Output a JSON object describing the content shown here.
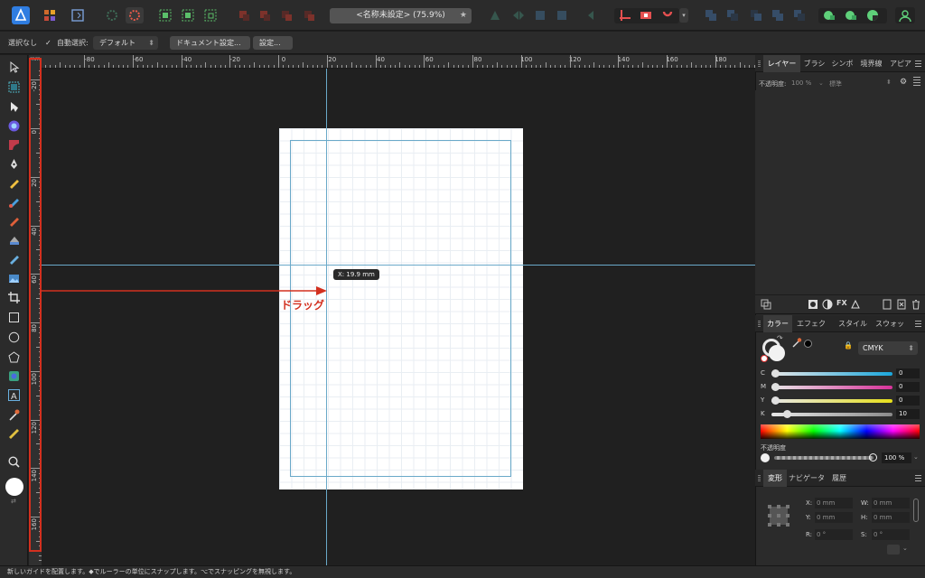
{
  "toolbar": {
    "document_title": "<名称未設定> (75.9%)",
    "favorite_icon": "star-icon"
  },
  "context_bar": {
    "selection_label": "選択なし",
    "auto_select_label": "自動選択:",
    "auto_select_value": "デフォルト",
    "document_setup_button": "ドキュメント設定...",
    "settings_button": "設定..."
  },
  "ruler": {
    "unit": "mm",
    "h_labels": [
      "-80",
      "-60",
      "-40",
      "-20",
      "0",
      "20",
      "40",
      "60",
      "80",
      "100",
      "120",
      "140",
      "160",
      "180"
    ],
    "v_labels": [
      "-20",
      "0",
      "20",
      "40",
      "60",
      "80",
      "100",
      "120",
      "140",
      "160"
    ]
  },
  "canvas": {
    "coordinate_tooltip": "X: 19.9 mm",
    "drag_annotation": "ドラッグ",
    "annotation_color": "#d3301f",
    "guide_color": "#6aa9c9"
  },
  "layers_panel": {
    "tabs": [
      "レイヤー",
      "ブラシ",
      "シンボ",
      "境界線",
      "アピア"
    ],
    "opacity_label": "不透明度:",
    "opacity_value": "100 %",
    "blend_mode": "標準"
  },
  "color_panel": {
    "tabs": [
      "カラー",
      "エフェク",
      "スタイル",
      "スウォッ"
    ],
    "model": "CMYK",
    "channels": [
      {
        "label": "C",
        "value": "0",
        "color": "#1aa7dc"
      },
      {
        "label": "M",
        "value": "0",
        "color": "#d8329a"
      },
      {
        "label": "Y",
        "value": "0",
        "color": "#e6df1a"
      },
      {
        "label": "K",
        "value": "10",
        "color": "#8a8a8a"
      }
    ],
    "opacity_label": "不透明度",
    "opacity_value": "100 %"
  },
  "transform_panel": {
    "tabs": [
      "変形",
      "ナビゲータ",
      "履歴"
    ],
    "x_label": "X:",
    "x_value": "0 mm",
    "y_label": "Y:",
    "y_value": "0 mm",
    "w_label": "W:",
    "w_value": "0 mm",
    "h_label": "H:",
    "h_value": "0 mm",
    "r_label": "R:",
    "r_value": "0 °",
    "s_label": "S:",
    "s_value": "0 °"
  },
  "status_bar": {
    "text": "新しいガイドを配置します。◆でルーラーの単位にスナップします。⌥でスナッピングを無視します。"
  }
}
